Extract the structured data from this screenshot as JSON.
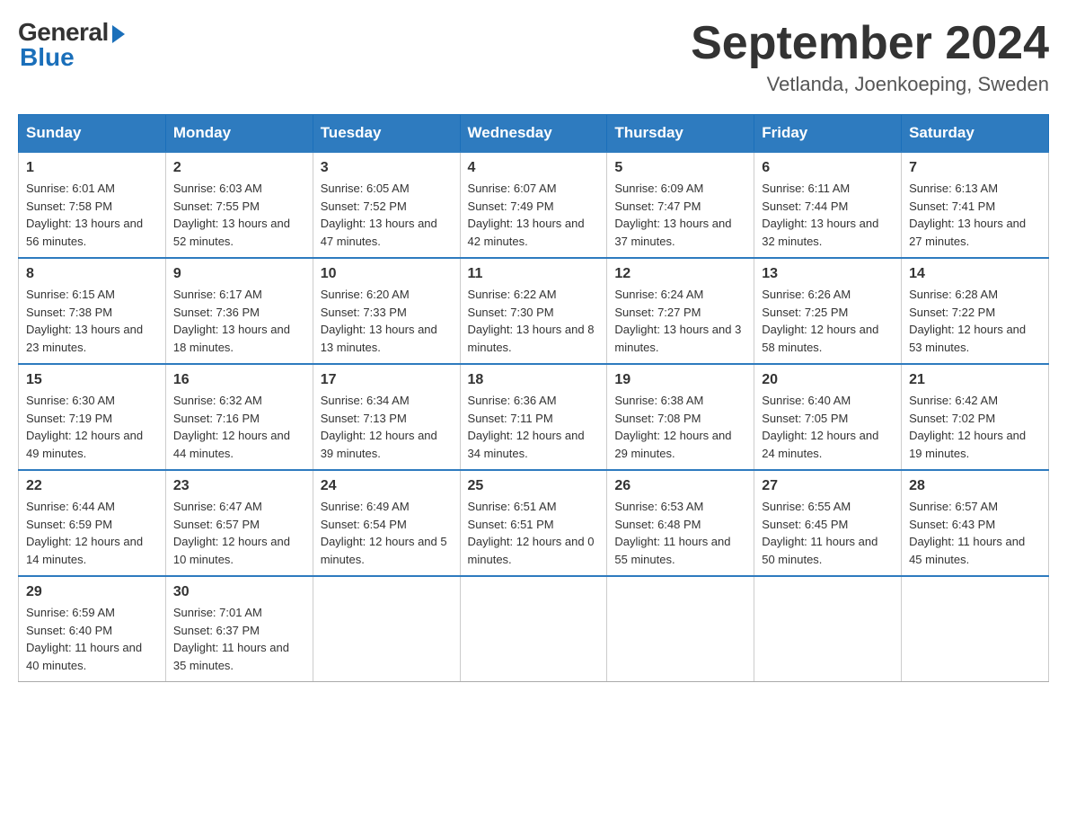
{
  "header": {
    "logo_general": "General",
    "logo_blue": "Blue",
    "month_year": "September 2024",
    "location": "Vetlanda, Joenkoeping, Sweden"
  },
  "days_of_week": [
    "Sunday",
    "Monday",
    "Tuesday",
    "Wednesday",
    "Thursday",
    "Friday",
    "Saturday"
  ],
  "weeks": [
    [
      {
        "day": "1",
        "sunrise": "Sunrise: 6:01 AM",
        "sunset": "Sunset: 7:58 PM",
        "daylight": "Daylight: 13 hours and 56 minutes."
      },
      {
        "day": "2",
        "sunrise": "Sunrise: 6:03 AM",
        "sunset": "Sunset: 7:55 PM",
        "daylight": "Daylight: 13 hours and 52 minutes."
      },
      {
        "day": "3",
        "sunrise": "Sunrise: 6:05 AM",
        "sunset": "Sunset: 7:52 PM",
        "daylight": "Daylight: 13 hours and 47 minutes."
      },
      {
        "day": "4",
        "sunrise": "Sunrise: 6:07 AM",
        "sunset": "Sunset: 7:49 PM",
        "daylight": "Daylight: 13 hours and 42 minutes."
      },
      {
        "day": "5",
        "sunrise": "Sunrise: 6:09 AM",
        "sunset": "Sunset: 7:47 PM",
        "daylight": "Daylight: 13 hours and 37 minutes."
      },
      {
        "day": "6",
        "sunrise": "Sunrise: 6:11 AM",
        "sunset": "Sunset: 7:44 PM",
        "daylight": "Daylight: 13 hours and 32 minutes."
      },
      {
        "day": "7",
        "sunrise": "Sunrise: 6:13 AM",
        "sunset": "Sunset: 7:41 PM",
        "daylight": "Daylight: 13 hours and 27 minutes."
      }
    ],
    [
      {
        "day": "8",
        "sunrise": "Sunrise: 6:15 AM",
        "sunset": "Sunset: 7:38 PM",
        "daylight": "Daylight: 13 hours and 23 minutes."
      },
      {
        "day": "9",
        "sunrise": "Sunrise: 6:17 AM",
        "sunset": "Sunset: 7:36 PM",
        "daylight": "Daylight: 13 hours and 18 minutes."
      },
      {
        "day": "10",
        "sunrise": "Sunrise: 6:20 AM",
        "sunset": "Sunset: 7:33 PM",
        "daylight": "Daylight: 13 hours and 13 minutes."
      },
      {
        "day": "11",
        "sunrise": "Sunrise: 6:22 AM",
        "sunset": "Sunset: 7:30 PM",
        "daylight": "Daylight: 13 hours and 8 minutes."
      },
      {
        "day": "12",
        "sunrise": "Sunrise: 6:24 AM",
        "sunset": "Sunset: 7:27 PM",
        "daylight": "Daylight: 13 hours and 3 minutes."
      },
      {
        "day": "13",
        "sunrise": "Sunrise: 6:26 AM",
        "sunset": "Sunset: 7:25 PM",
        "daylight": "Daylight: 12 hours and 58 minutes."
      },
      {
        "day": "14",
        "sunrise": "Sunrise: 6:28 AM",
        "sunset": "Sunset: 7:22 PM",
        "daylight": "Daylight: 12 hours and 53 minutes."
      }
    ],
    [
      {
        "day": "15",
        "sunrise": "Sunrise: 6:30 AM",
        "sunset": "Sunset: 7:19 PM",
        "daylight": "Daylight: 12 hours and 49 minutes."
      },
      {
        "day": "16",
        "sunrise": "Sunrise: 6:32 AM",
        "sunset": "Sunset: 7:16 PM",
        "daylight": "Daylight: 12 hours and 44 minutes."
      },
      {
        "day": "17",
        "sunrise": "Sunrise: 6:34 AM",
        "sunset": "Sunset: 7:13 PM",
        "daylight": "Daylight: 12 hours and 39 minutes."
      },
      {
        "day": "18",
        "sunrise": "Sunrise: 6:36 AM",
        "sunset": "Sunset: 7:11 PM",
        "daylight": "Daylight: 12 hours and 34 minutes."
      },
      {
        "day": "19",
        "sunrise": "Sunrise: 6:38 AM",
        "sunset": "Sunset: 7:08 PM",
        "daylight": "Daylight: 12 hours and 29 minutes."
      },
      {
        "day": "20",
        "sunrise": "Sunrise: 6:40 AM",
        "sunset": "Sunset: 7:05 PM",
        "daylight": "Daylight: 12 hours and 24 minutes."
      },
      {
        "day": "21",
        "sunrise": "Sunrise: 6:42 AM",
        "sunset": "Sunset: 7:02 PM",
        "daylight": "Daylight: 12 hours and 19 minutes."
      }
    ],
    [
      {
        "day": "22",
        "sunrise": "Sunrise: 6:44 AM",
        "sunset": "Sunset: 6:59 PM",
        "daylight": "Daylight: 12 hours and 14 minutes."
      },
      {
        "day": "23",
        "sunrise": "Sunrise: 6:47 AM",
        "sunset": "Sunset: 6:57 PM",
        "daylight": "Daylight: 12 hours and 10 minutes."
      },
      {
        "day": "24",
        "sunrise": "Sunrise: 6:49 AM",
        "sunset": "Sunset: 6:54 PM",
        "daylight": "Daylight: 12 hours and 5 minutes."
      },
      {
        "day": "25",
        "sunrise": "Sunrise: 6:51 AM",
        "sunset": "Sunset: 6:51 PM",
        "daylight": "Daylight: 12 hours and 0 minutes."
      },
      {
        "day": "26",
        "sunrise": "Sunrise: 6:53 AM",
        "sunset": "Sunset: 6:48 PM",
        "daylight": "Daylight: 11 hours and 55 minutes."
      },
      {
        "day": "27",
        "sunrise": "Sunrise: 6:55 AM",
        "sunset": "Sunset: 6:45 PM",
        "daylight": "Daylight: 11 hours and 50 minutes."
      },
      {
        "day": "28",
        "sunrise": "Sunrise: 6:57 AM",
        "sunset": "Sunset: 6:43 PM",
        "daylight": "Daylight: 11 hours and 45 minutes."
      }
    ],
    [
      {
        "day": "29",
        "sunrise": "Sunrise: 6:59 AM",
        "sunset": "Sunset: 6:40 PM",
        "daylight": "Daylight: 11 hours and 40 minutes."
      },
      {
        "day": "30",
        "sunrise": "Sunrise: 7:01 AM",
        "sunset": "Sunset: 6:37 PM",
        "daylight": "Daylight: 11 hours and 35 minutes."
      },
      null,
      null,
      null,
      null,
      null
    ]
  ]
}
